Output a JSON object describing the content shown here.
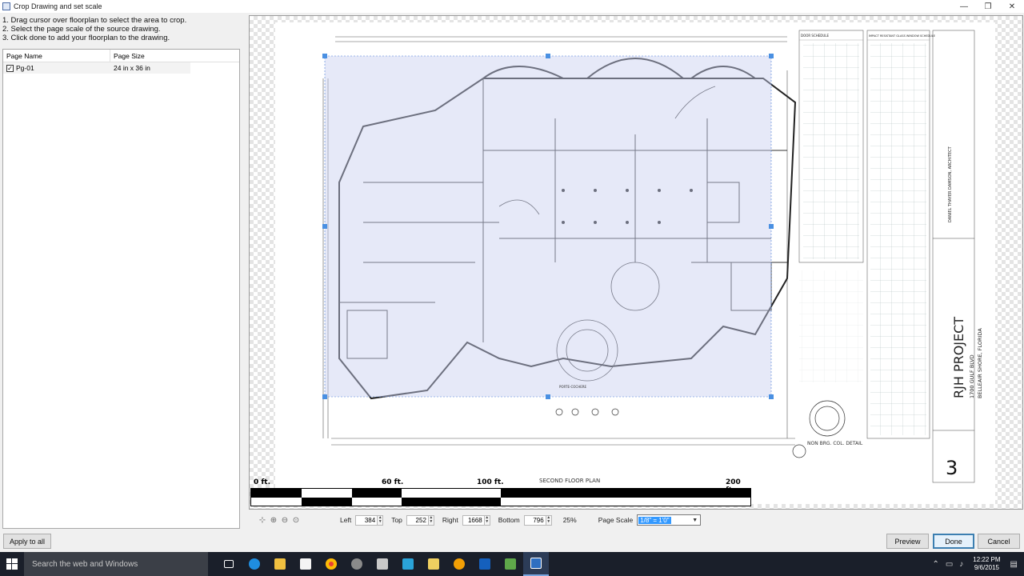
{
  "window": {
    "title": "Crop Drawing and set scale",
    "controls": [
      "—",
      "❐",
      "✕"
    ]
  },
  "instructions": [
    "1. Drag cursor over floorplan to select the area to crop.",
    "2. Select the page scale of the source drawing.",
    "3. Click done to add your floorplan to the drawing."
  ],
  "page_list": {
    "headers": [
      "Page Name",
      "Page Size"
    ],
    "rows": [
      {
        "checked": true,
        "name": "Pg-01",
        "size": "24 in x 36 in"
      }
    ]
  },
  "apply_all_label": "Apply to all",
  "drawing": {
    "floor_plan_title": "SECOND FLOOR PLAN",
    "project_name": "RJH PROJECT",
    "project_address_1": "1700 GULF BLVD",
    "project_address_2": "BELLEAIR SHORE, FLORIDA",
    "architect": "DANIEL THAYER DAMSON, ARCHITECT",
    "sheet_number": "3",
    "schedule_title_1": "DOOR SCHEDULE",
    "schedule_title_2": "IMPACT RESISTANT GLASS WINDOW SCHEDULE",
    "detail_label": "NON BRG. COL. DETAIL",
    "porte_cochere": "PORTE-COCHERE"
  },
  "scalebar": {
    "labels": [
      "0 ft.",
      "60 ft.",
      "100 ft.",
      "200 ft."
    ]
  },
  "crop": {
    "left_label": "Left",
    "left": "384",
    "top_label": "Top",
    "top": "252",
    "right_label": "Right",
    "right": "1668",
    "bottom_label": "Bottom",
    "bottom": "796",
    "zoom": "25%",
    "page_scale_label": "Page Scale",
    "page_scale": "1/8\" = 1'0\""
  },
  "buttons": {
    "preview": "Preview",
    "done": "Done",
    "cancel": "Cancel"
  },
  "taskbar": {
    "search_placeholder": "Search the web and Windows",
    "time": "12:22 PM",
    "date": "9/6/2015"
  }
}
